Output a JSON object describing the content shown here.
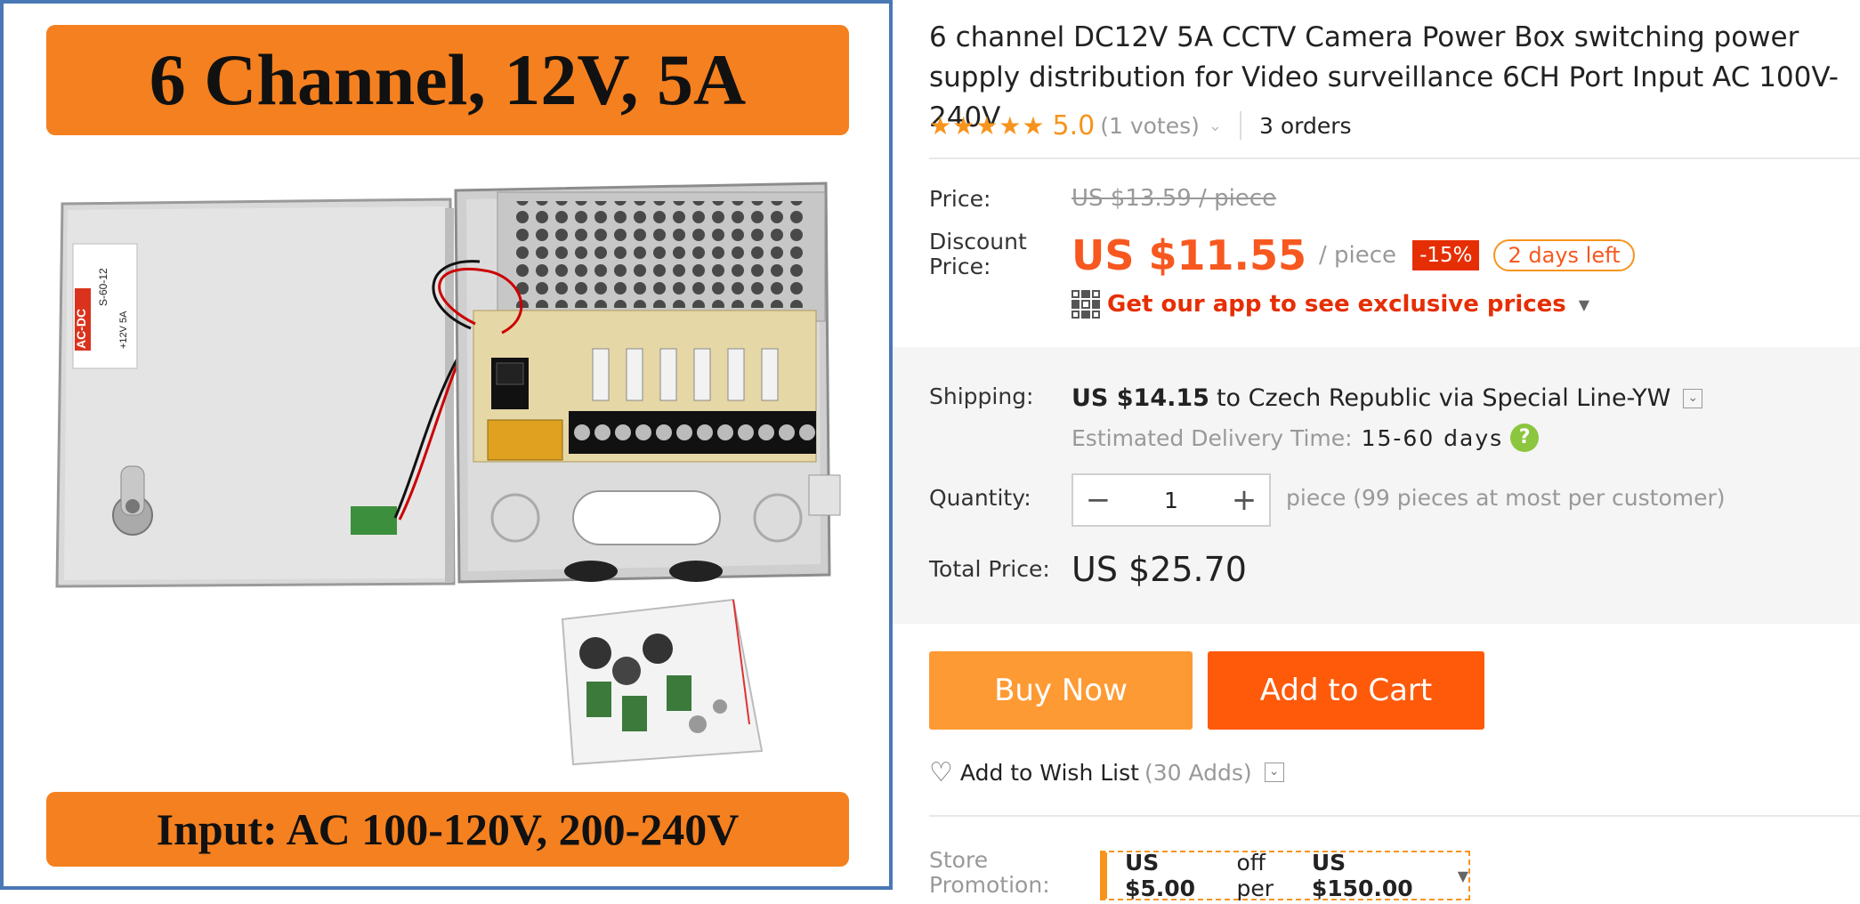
{
  "image": {
    "banner_top": "6 Channel, 12V, 5A",
    "banner_bottom": "Input: AC 100-120V,  200-240V",
    "label_brand": "AC-DC",
    "label_model": "S-60-12",
    "label_output": "+12V  5A"
  },
  "product": {
    "title": "6 channel DC12V 5A CCTV Camera Power Box switching power supply distribution for Video surveillance 6CH Port Input AC 100V-240V",
    "rating": "5.0",
    "votes": "(1 votes)",
    "orders": "3 orders"
  },
  "price": {
    "label": "Price:",
    "original": "US $13.59 / piece",
    "discount_label_line1": "Discount",
    "discount_label_line2": "Price:",
    "discount_value": "US $11.55",
    "per_piece": "/ piece",
    "discount_pct": "-15%",
    "days_left": "2 days left",
    "app_promo": "Get our app to see exclusive prices"
  },
  "shipping": {
    "label": "Shipping:",
    "cost": "US $14.15",
    "to_text": "to Czech Republic via Special Line-YW",
    "estimated_label": "Estimated Delivery Time:",
    "estimated_days": "15-60 days"
  },
  "quantity": {
    "label": "Quantity:",
    "value": "1",
    "minus": "−",
    "plus": "+",
    "note": "piece (99 pieces at most per customer)"
  },
  "total": {
    "label": "Total Price:",
    "value": "US $25.70"
  },
  "actions": {
    "buy_now": "Buy Now",
    "add_to_cart": "Add to Cart",
    "wish_list": "Add to Wish List",
    "wish_count": "(30 Adds)"
  },
  "promotion": {
    "label_line1": "Store",
    "label_line2": "Promotion:",
    "discount": "US $5.00",
    "middle": "off per",
    "threshold": "US $150.00"
  },
  "colors": {
    "accent_orange": "#f7581f",
    "buy_now": "#fe9a33",
    "add_to_cart": "#fe5a0a",
    "badge_red": "#e62e04",
    "banner_orange": "#f5801f",
    "frame_blue": "#4a78b5"
  },
  "icons": [
    "star-icon",
    "chevron-down-icon",
    "qr-code-icon",
    "help-icon",
    "heart-plus-icon",
    "dropdown-caret-icon"
  ]
}
